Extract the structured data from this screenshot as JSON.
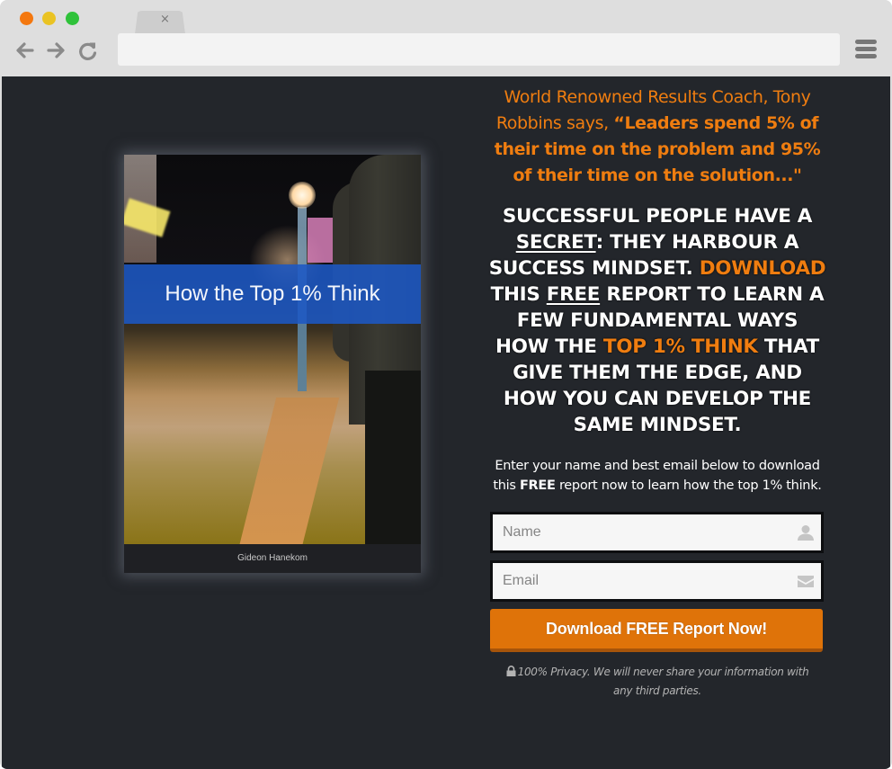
{
  "browser": {
    "tab_close": "×",
    "address_value": "",
    "icons": {
      "back": "arrow-left",
      "forward": "arrow-right",
      "reload": "reload",
      "menu": "hamburger-menu"
    },
    "traffic_colors": {
      "close": "#f4780f",
      "minimize": "#eac323",
      "maximize": "#2fc23a"
    }
  },
  "book": {
    "title": "How the Top 1% Think",
    "author": "Gideon Hanekom",
    "band_color": "#1c58c4"
  },
  "quote": {
    "intro": "World Renowned Results Coach, Tony Robbins says, ",
    "emphasis": "“Leaders spend 5% of their time on the problem and 95% of their time on the solution...\""
  },
  "headline": {
    "part1": "SUCCESSFUL PEOPLE HAVE A ",
    "secret": "SECRET",
    "part2": ": THEY HARBOUR A SUCCESS MINDSET. ",
    "download": "DOWNLOAD",
    "part3": " THIS ",
    "free": "FREE",
    "part4": " REPORT TO LEARN A FEW FUNDAMENTAL WAYS HOW THE ",
    "top": "TOP 1% THINK",
    "part5": " THAT GIVE THEM THE EDGE, AND HOW YOU CAN DEVELOP THE SAME MINDSET."
  },
  "intro": {
    "part1": "Enter your name and best email below to download this ",
    "free": "FREE",
    "part2": " report now to learn how the top 1% think."
  },
  "form": {
    "name_placeholder": "Name",
    "name_value": "",
    "email_placeholder": "Email",
    "email_value": "",
    "submit_label": "Download FREE Report Now!",
    "privacy": "100% Privacy. We will never share your information with any third parties."
  },
  "colors": {
    "accent": "#ef7d10",
    "button": "#df7309",
    "page_bg": "#23262b"
  }
}
